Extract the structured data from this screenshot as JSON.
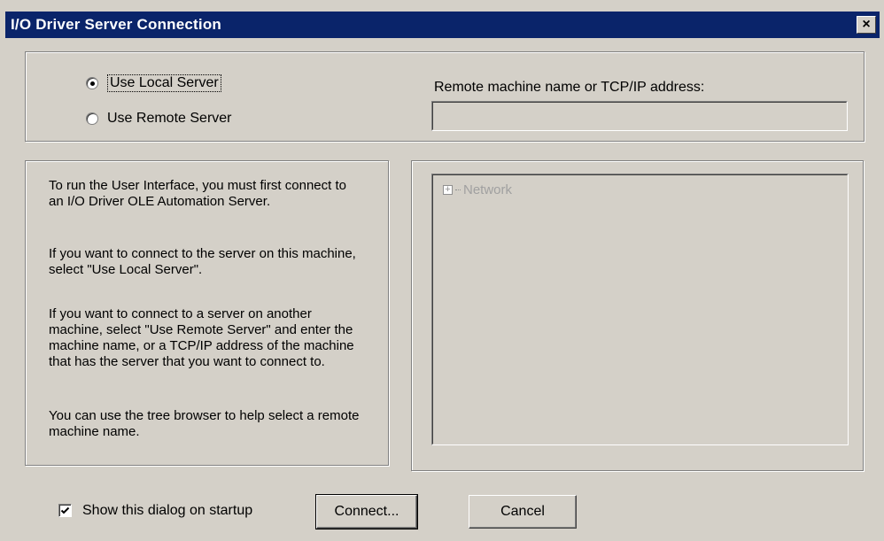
{
  "window": {
    "title": "I/O Driver Server Connection",
    "close_glyph": "×"
  },
  "server_mode": {
    "local_label": "Use Local Server",
    "remote_label": "Use Remote Server",
    "selected": "local"
  },
  "remote": {
    "label": "Remote machine name or TCP/IP address:",
    "value": ""
  },
  "info": {
    "paragraphs": [
      "To run the User Interface, you must first connect to an  I/O Driver OLE Automation Server.",
      "If you want to connect to the server on this machine, select \"Use Local Server\".",
      "If you want to connect to a server on another machine, select \"Use Remote Server\" and enter the machine name, or a TCP/IP address of the machine that has the server that you want to connect to.",
      "You can use the tree browser to help select a remote machine name."
    ]
  },
  "tree": {
    "root_label": "Network",
    "expand_glyph": "+"
  },
  "footer": {
    "startup_checkbox_label": "Show this dialog on startup",
    "startup_checked": true,
    "connect_label": "Connect...",
    "cancel_label": "Cancel"
  },
  "colors": {
    "titlebar": "#0a246a",
    "dialog_bg": "#d4d0c8",
    "disabled_text": "#a0a0a0"
  }
}
